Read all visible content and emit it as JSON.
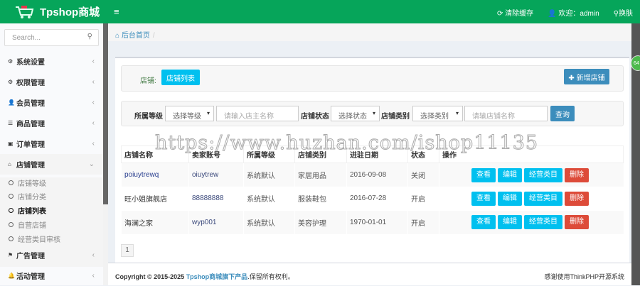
{
  "header": {
    "brand": "Tpshop商城",
    "menu_toggle": "≡",
    "clear_cache": "清除缓存",
    "welcome": "欢迎：admin",
    "skin": "换肤"
  },
  "sidebar": {
    "search_placeholder": "Search...",
    "items": [
      {
        "label": "系统设置",
        "icon": "⚙"
      },
      {
        "label": "权限管理",
        "icon": "⚙"
      },
      {
        "label": "会员管理",
        "icon": "👤"
      },
      {
        "label": "商品管理",
        "icon": "☰"
      },
      {
        "label": "订单管理",
        "icon": "▣"
      },
      {
        "label": "店铺管理",
        "icon": "⌂"
      },
      {
        "label": "广告管理",
        "icon": "⚑"
      },
      {
        "label": "活动管理",
        "icon": "🔔"
      }
    ],
    "sub_items": [
      {
        "label": "店铺等级"
      },
      {
        "label": "店铺分类"
      },
      {
        "label": "店铺列表"
      },
      {
        "label": "自营店铺"
      },
      {
        "label": "经营类目审核"
      }
    ]
  },
  "breadcrumb": {
    "home": "后台首页",
    "sep": "/"
  },
  "tabs": {
    "label": "店铺:",
    "active": "店铺列表",
    "add_button": "✚ 新增店铺"
  },
  "filter": {
    "grade_label": "所属等级",
    "grade_select": "选择等级",
    "owner_placeholder": "请输入店主名称",
    "status_label": "店铺状态",
    "status_select": "选择状态",
    "category_label": "店铺类别",
    "category_select": "选择类别",
    "store_placeholder": "请输店铺名称",
    "search_button": "查询"
  },
  "table": {
    "headers": [
      "店铺名称",
      "卖家账号",
      "所属等级",
      "店铺类别",
      "进驻日期",
      "状态",
      "操作"
    ],
    "rows": [
      [
        "poiuytrewq",
        "oiuytrew",
        "系统默认",
        "家居用品",
        "2016-09-08",
        "关闭"
      ],
      [
        "旺小姐旗舰店",
        "88888888",
        "系统默认",
        "服装鞋包",
        "2016-07-28",
        "开启"
      ],
      [
        "海澜之家",
        "wyp001",
        "系统默认",
        "美容护理",
        "1970-01-01",
        "开启"
      ]
    ],
    "actions": [
      "查看",
      "编辑",
      "经营类目",
      "删除"
    ]
  },
  "pagination": {
    "page": "1"
  },
  "footer": {
    "copyright": "Copyright © 2015-2025",
    "brand_link": "Tpshop商城旗下产品",
    "rights": ".保留所有权利。",
    "right": "感谢使用ThinkPHP开源系统"
  },
  "float_badge": "64",
  "watermark": "https://www.huzhan.com/ishop11135"
}
